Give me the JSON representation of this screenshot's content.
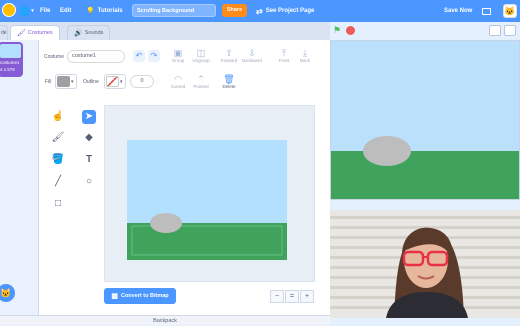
{
  "menu": {
    "file": "File",
    "edit": "Edit",
    "tutorials": "Tutorials",
    "project_title": "Scrolling Background",
    "share": "Share",
    "see_project_page": "See Project Page",
    "save_now": "Save Now"
  },
  "tabs": {
    "costumes": "Costumes",
    "sounds": "Sounds"
  },
  "sprite_thumb": {
    "line1": "costume1",
    "line2": "4 x 578"
  },
  "editor": {
    "costume_label": "Costume",
    "costume_name": "costume1",
    "fill_label": "Fill",
    "outline_label": "Outline",
    "outline_width": "0",
    "group": "Group",
    "ungroup": "Ungroup",
    "forward": "Forward",
    "backward": "Backward",
    "front": "Front",
    "back": "Back",
    "curved": "Curved",
    "pointed": "Pointed",
    "delete": "Delete",
    "convert": "Convert to Bitmap",
    "zoom_out": "−",
    "zoom_reset": "=",
    "zoom_in": "+"
  },
  "backpack": "Backpack",
  "colors": {
    "accent": "#4c97ff",
    "costume_tab": "#855cd6",
    "share": "#ff8c1a",
    "sky": "#b3e0ff",
    "grass": "#3fa35c",
    "rock": "#bdbdbd"
  }
}
